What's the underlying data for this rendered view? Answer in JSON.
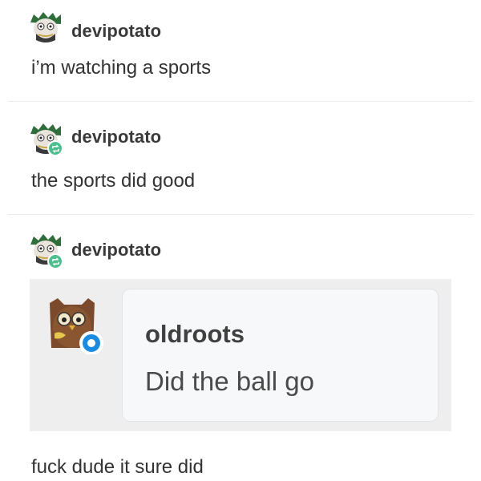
{
  "posts": [
    {
      "username": "devipotato",
      "text": "i’m watching a sports",
      "reblogged": false
    },
    {
      "username": "devipotato",
      "text": "the sports did good",
      "reblogged": true
    },
    {
      "username": "devipotato",
      "reblogged": true,
      "quote": {
        "username": "oldroots",
        "text": "Did the ball go"
      },
      "text": "fuck dude it sure did"
    }
  ],
  "colors": {
    "reblog_badge": "#4dbf8e",
    "quote_badge": "#1a8be0",
    "divider": "#ececec",
    "quote_panel": "#eeeeee"
  },
  "icons": {
    "avatar": "cartoon-character-avatar-icon",
    "reblog": "reblog-arrows-icon",
    "quote_avatar": "owl-avatar-icon"
  }
}
